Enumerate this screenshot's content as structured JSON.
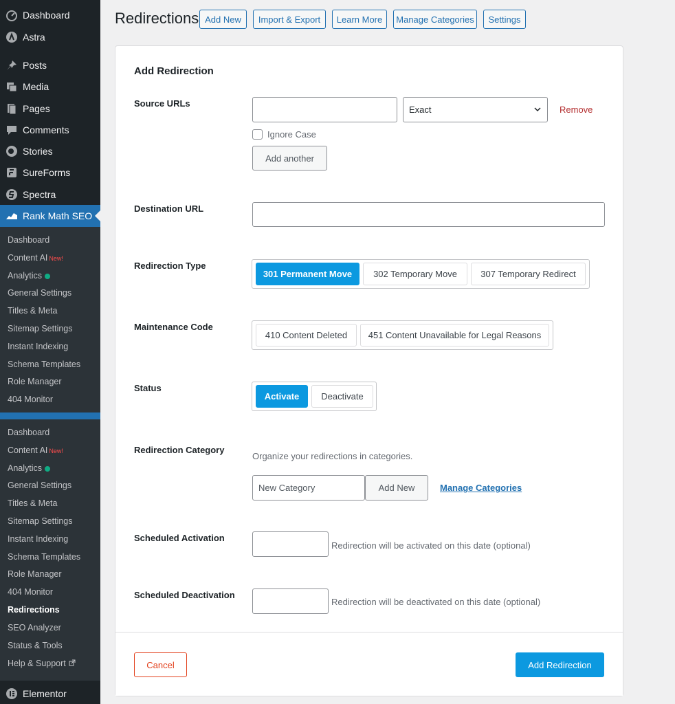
{
  "sidebar": {
    "top_items": [
      {
        "label": "Dashboard",
        "icon": "dashboard-icon"
      },
      {
        "label": "Astra",
        "icon": "astra-icon"
      },
      {
        "label": "Posts",
        "icon": "pin-icon"
      },
      {
        "label": "Media",
        "icon": "media-icon"
      },
      {
        "label": "Pages",
        "icon": "pages-icon"
      },
      {
        "label": "Comments",
        "icon": "comment-icon"
      },
      {
        "label": "Stories",
        "icon": "stories-icon"
      },
      {
        "label": "SureForms",
        "icon": "sureforms-icon"
      },
      {
        "label": "Spectra",
        "icon": "spectra-icon"
      },
      {
        "label": "Rank Math SEO",
        "icon": "rank-math-icon"
      }
    ],
    "submenu_1": [
      {
        "label": "Dashboard"
      },
      {
        "label": "Content AI",
        "badge": "New!"
      },
      {
        "label": "Analytics",
        "dot": true
      },
      {
        "label": "General Settings"
      },
      {
        "label": "Titles & Meta"
      },
      {
        "label": "Sitemap Settings"
      },
      {
        "label": "Instant Indexing"
      },
      {
        "label": "Schema Templates"
      },
      {
        "label": "Role Manager"
      },
      {
        "label": "404 Monitor"
      }
    ],
    "submenu_2": [
      {
        "label": "Dashboard"
      },
      {
        "label": "Content AI",
        "badge": "New!"
      },
      {
        "label": "Analytics",
        "dot": true
      },
      {
        "label": "General Settings"
      },
      {
        "label": "Titles & Meta"
      },
      {
        "label": "Sitemap Settings"
      },
      {
        "label": "Instant Indexing"
      },
      {
        "label": "Schema Templates"
      },
      {
        "label": "Role Manager"
      },
      {
        "label": "404 Monitor"
      },
      {
        "label": "Redirections",
        "current": true
      },
      {
        "label": "SEO Analyzer"
      },
      {
        "label": "Status & Tools"
      },
      {
        "label": "Help & Support",
        "external": true
      }
    ],
    "bottom_item": {
      "label": "Elementor",
      "icon": "elementor-icon"
    }
  },
  "header": {
    "title": "Redirections",
    "buttons": [
      "Add New",
      "Import & Export",
      "Learn More",
      "Manage Categories",
      "Settings"
    ]
  },
  "form": {
    "title": "Add Redirection",
    "source": {
      "label": "Source URLs",
      "url_value": "",
      "match_type": "Exact",
      "remove": "Remove",
      "ignore_case": "Ignore Case",
      "ignore_case_checked": false,
      "add_another": "Add another"
    },
    "destination": {
      "label": "Destination URL",
      "value": ""
    },
    "redirection_type": {
      "label": "Redirection Type",
      "options": [
        "301 Permanent Move",
        "302 Temporary Move",
        "307 Temporary Redirect"
      ],
      "selected": "301 Permanent Move"
    },
    "maintenance_code": {
      "label": "Maintenance Code",
      "options": [
        "410 Content Deleted",
        "451 Content Unavailable for Legal Reasons"
      ]
    },
    "status": {
      "label": "Status",
      "options": [
        "Activate",
        "Deactivate"
      ],
      "selected": "Activate"
    },
    "category": {
      "label": "Redirection Category",
      "helper": "Organize your redirections in categories.",
      "placeholder": "New Category",
      "add_new": "Add New",
      "manage": "Manage Categories"
    },
    "scheduled_activation": {
      "label": "Scheduled Activation",
      "helper": "Redirection will be activated on this date (optional)"
    },
    "scheduled_deactivation": {
      "label": "Scheduled Deactivation",
      "helper": "Redirection will be deactivated on this date (optional)"
    },
    "cancel": "Cancel",
    "submit": "Add Redirection"
  },
  "colors": {
    "sidebar_bg": "#1d2327",
    "submenu_bg": "#2c3338",
    "wp_blue": "#2271b1",
    "primary": "#0c99e0",
    "danger": "#e2401c",
    "remove": "#b32d2e",
    "analytics_dot": "#10ac84"
  }
}
